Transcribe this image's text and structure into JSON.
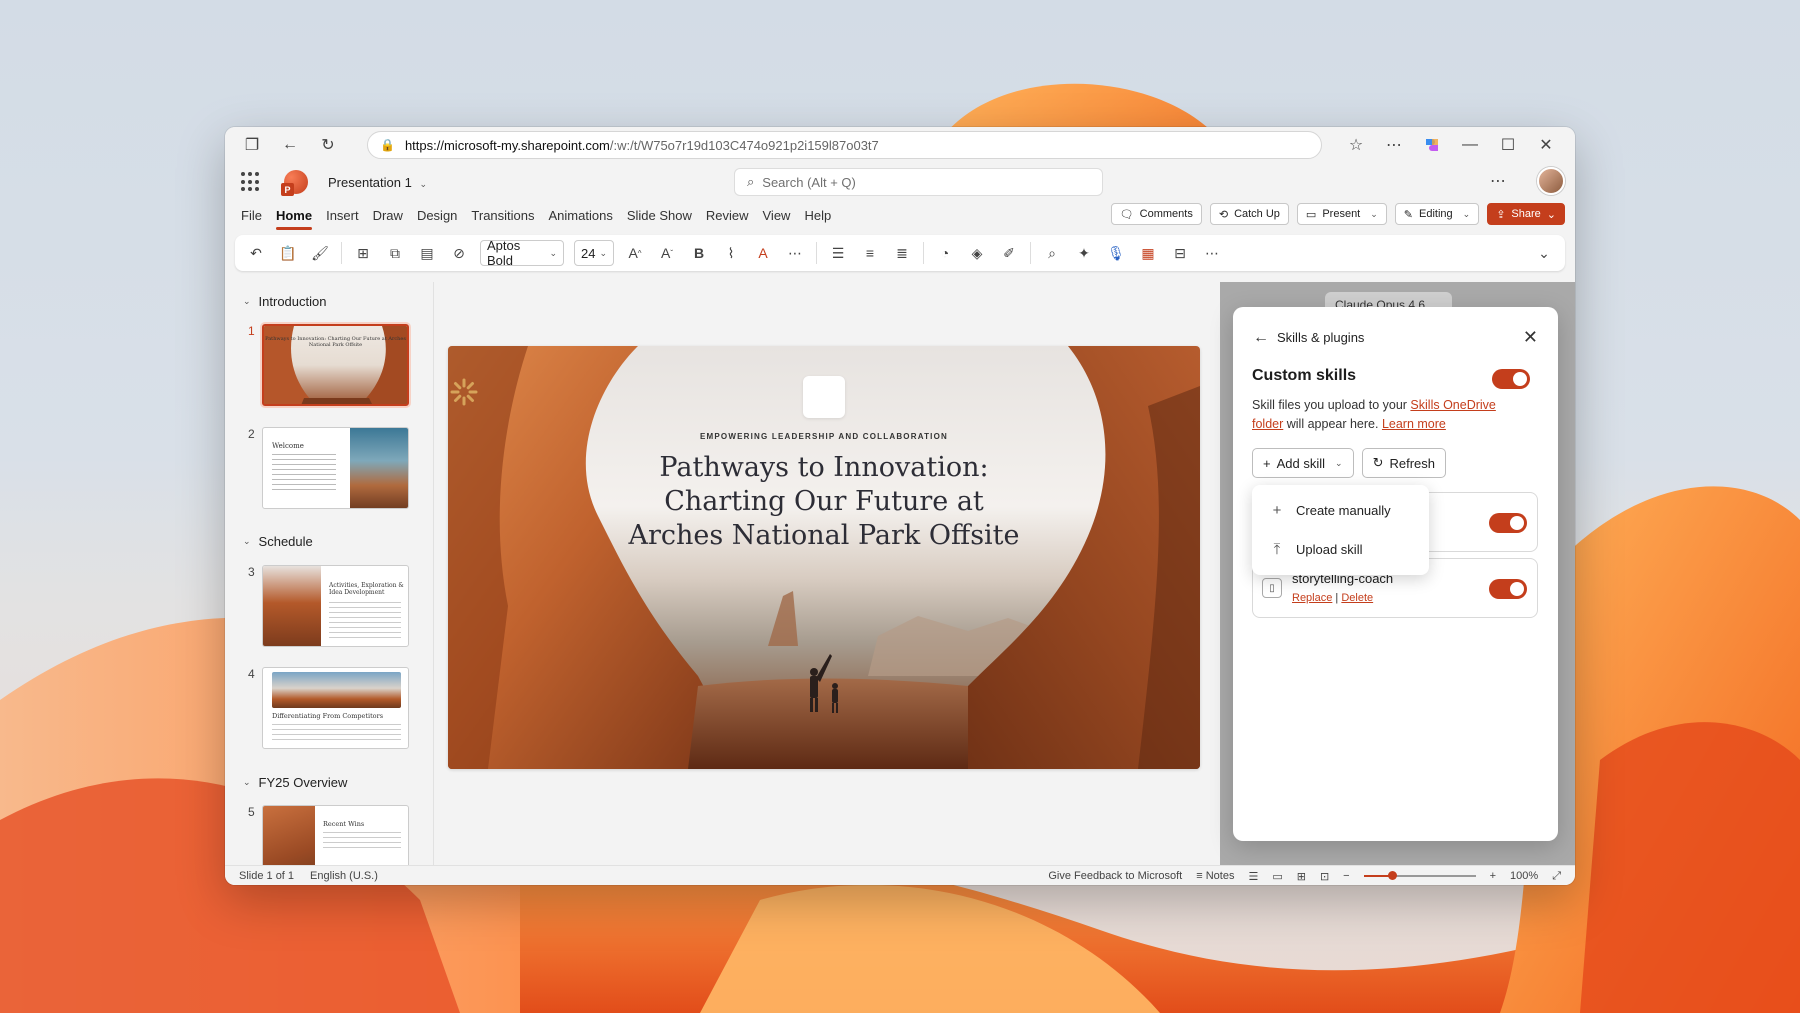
{
  "browser": {
    "url_host": "https://microsoft-my.sharepoint.com",
    "url_path": "/:w:/t/W75o7r19d103C474o921p2i159l87o03t7"
  },
  "app": {
    "doc_title": "Presentation 1",
    "search_placeholder": "Search (Alt + Q)"
  },
  "menu": {
    "tabs": [
      "File",
      "Home",
      "Insert",
      "Draw",
      "Design",
      "Transitions",
      "Animations",
      "Slide Show",
      "Review",
      "View",
      "Help"
    ],
    "active_tab": "Home",
    "comments": "Comments",
    "catch_up": "Catch Up",
    "present": "Present",
    "editing": "Editing",
    "share": "Share"
  },
  "ribbon": {
    "font_name": "Aptos Bold",
    "font_size": "24"
  },
  "thumbnails": {
    "sections": [
      "Introduction",
      "Schedule",
      "FY25 Overview"
    ],
    "slides": [
      {
        "num": "1",
        "title": "Pathways to Innovation: Charting Our Future at Arches National Park Offsite"
      },
      {
        "num": "2",
        "title": "Welcome"
      },
      {
        "num": "3",
        "title": "Activities, Exploration & Idea Development"
      },
      {
        "num": "4",
        "title": "Differentiating From Competitors"
      },
      {
        "num": "5",
        "title": "Recent Wins"
      }
    ]
  },
  "slide": {
    "kicker": "EMPOWERING LEADERSHIP AND COLLABORATION",
    "title_line1": "Pathways to Innovation:",
    "title_line2": "Charting Our Future at",
    "title_line3": "Arches National Park Offsite"
  },
  "side": {
    "model": "Claude Opus 4.6"
  },
  "panel": {
    "header": "Skills & plugins",
    "section_title": "Custom skills",
    "desc_pre": "Skill files you upload to your ",
    "desc_link": "Skills OneDrive folder",
    "desc_mid": " will appear here. ",
    "desc_learn": "Learn more",
    "add_skill": "Add skill",
    "refresh": "Refresh",
    "dropdown": [
      "Create manually",
      "Upload skill"
    ],
    "skills": [
      {
        "name": "storytelling-coach",
        "replace": "Replace",
        "sep": "|",
        "delete": "Delete"
      }
    ]
  },
  "status": {
    "slide_of": "Slide 1 of 1",
    "language": "English (U.S.)",
    "feedback": "Give Feedback to Microsoft",
    "notes": "Notes",
    "zoom": "100%",
    "zoom_level": 0.25
  },
  "colors": {
    "accent": "#c43e1c",
    "panel_bg": "#ffffff"
  }
}
